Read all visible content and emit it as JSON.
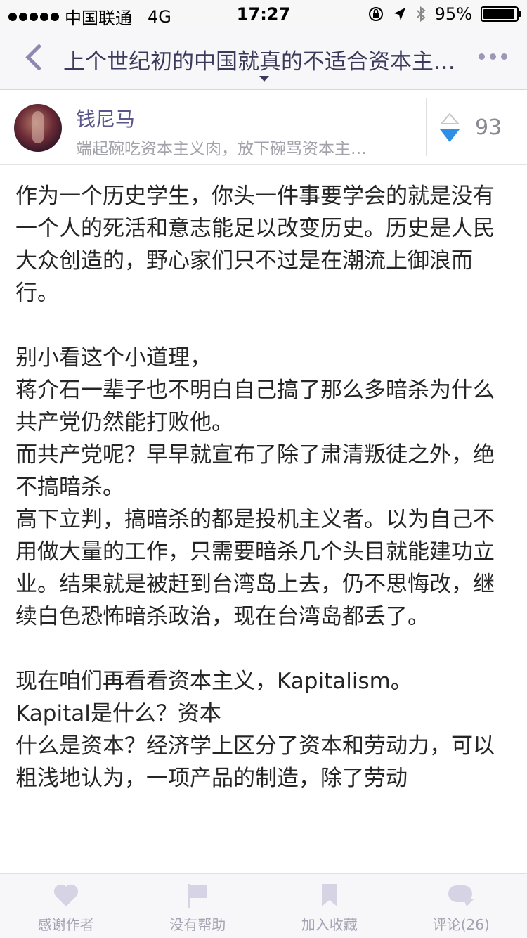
{
  "status_bar": {
    "carrier": "中国联通",
    "network": "4G",
    "time": "17:27",
    "battery_percent": "95%",
    "battery_level": 0.95
  },
  "nav": {
    "title": "上个世纪初的中国就真的不适合资本主…"
  },
  "author": {
    "name": "钱尼马",
    "bio": "端起碗吃资本主义肉，放下碗骂资本主…",
    "vote_count": "93"
  },
  "article": {
    "paragraphs": [
      "作为一个历史学生，你头一件事要学会的就是没有一个人的死活和意志能足以改变历史。历史是人民大众创造的，野心家们只不过是在潮流上御浪而行。",
      "别小看这个小道理，\n蒋介石一辈子也不明白自己搞了那么多暗杀为什么共产党仍然能打败他。\n而共产党呢？早早就宣布了除了肃清叛徒之外，绝不搞暗杀。\n高下立判，搞暗杀的都是投机主义者。以为自己不用做大量的工作，只需要暗杀几个头目就能建功立业。结果就是被赶到台湾岛上去，仍不思悔改，继续白色恐怖暗杀政治，现在台湾岛都丢了。",
      "现在咱们再看看资本主义，Kapitalism。\nKapital是什么？资本\n什么是资本？经济学上区分了资本和劳动力，可以粗浅地认为，一项产品的制造，除了劳动"
    ]
  },
  "tabbar": {
    "thank": "感谢作者",
    "unhelpful": "没有帮助",
    "favorite": "加入收藏",
    "comments": "评论(26)"
  },
  "colors": {
    "accent": "#5b5689",
    "vote_down": "#2d8fe6",
    "tab_icon": "#d6d4e4"
  }
}
